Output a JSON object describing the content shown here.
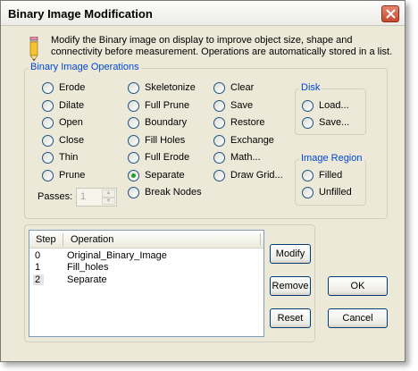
{
  "window": {
    "title": "Binary Image Modification",
    "description": "Modify the Binary image on display to improve object size, shape and connectivity before measurement. Operations are automatically stored in a list."
  },
  "operations_group": {
    "label": "Binary Image Operations",
    "column1": [
      "Erode",
      "Dilate",
      "Open",
      "Close",
      "Thin",
      "Prune"
    ],
    "column2": [
      "Skeletonize",
      "Full Prune",
      "Boundary",
      "Fill Holes",
      "Full Erode",
      "Separate",
      "Break Nodes"
    ],
    "column3": [
      "Clear",
      "Save",
      "Restore",
      "Exchange",
      "Math...",
      "Draw Grid..."
    ],
    "selected": "Separate",
    "passes_label": "Passes:",
    "passes_value": "1"
  },
  "disk_group": {
    "label": "Disk",
    "options": [
      "Load...",
      "Save..."
    ]
  },
  "image_region_group": {
    "label": "Image Region",
    "options": [
      "Filled",
      "Unfilled"
    ]
  },
  "operation_list": {
    "columns": [
      "Step",
      "Operation"
    ],
    "rows": [
      {
        "step": "0",
        "operation": "Original_Binary_Image"
      },
      {
        "step": "1",
        "operation": "Fill_holes"
      },
      {
        "step": "2",
        "operation": "Separate"
      }
    ],
    "selected_step": "2"
  },
  "buttons": {
    "modify": "Modify",
    "remove": "Remove",
    "reset": "Reset",
    "ok": "OK",
    "cancel": "Cancel"
  },
  "colors": {
    "group_label": "#0046d5",
    "window_bg": "#ece9d8",
    "checked_radio": "#21a121"
  }
}
